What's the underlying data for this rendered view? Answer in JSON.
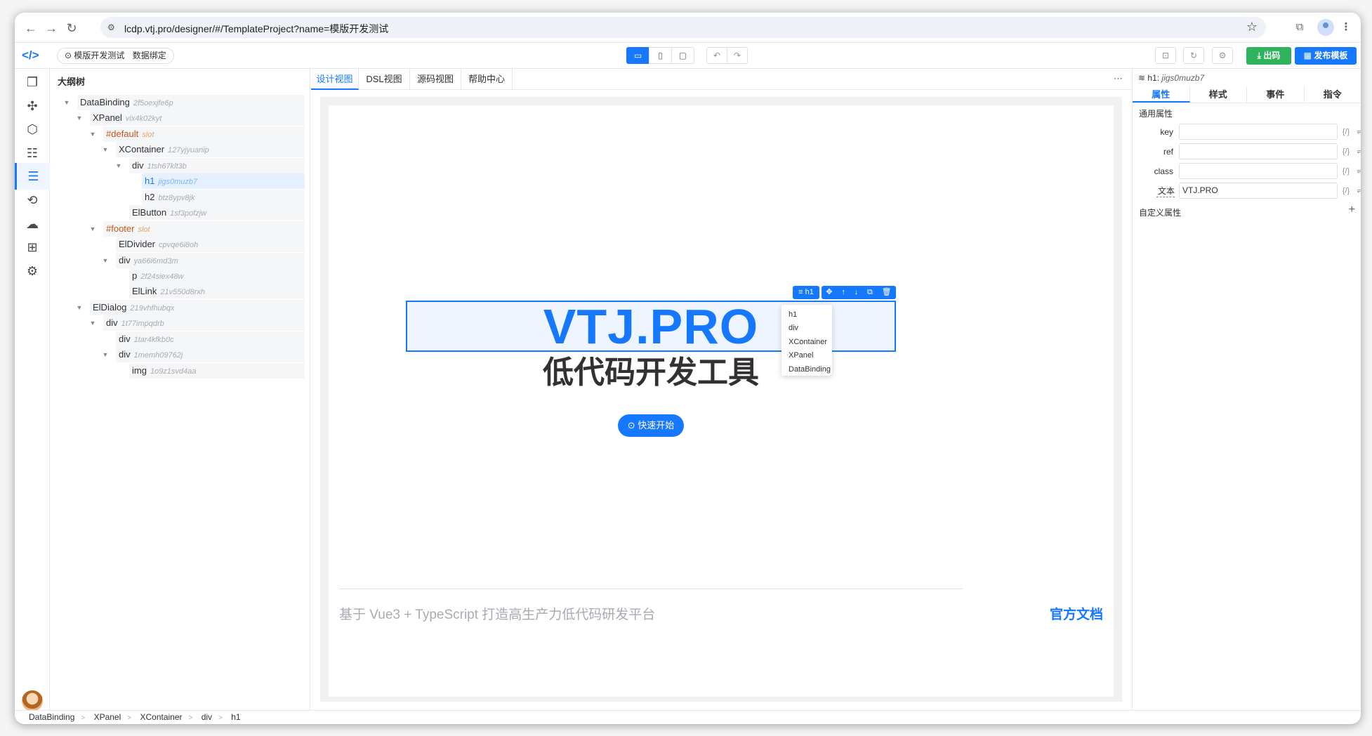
{
  "browser": {
    "url": "lcdp.vtj.pro/designer/#/TemplateProject?name=模版开发测试",
    "back_icon": "arrow-left-icon",
    "forward_icon": "arrow-right-icon",
    "reload_icon": "reload-icon"
  },
  "toolbar": {
    "project_name": "模版开发测试",
    "data_binding": "数据绑定",
    "export_label": "出码",
    "publish_label": "发布模板"
  },
  "tree": {
    "title": "大纲树",
    "nodes": [
      {
        "name": "DataBinding",
        "id": "2f5oexjfe6p"
      },
      {
        "name": "XPanel",
        "id": "vix4k02kyt"
      },
      {
        "name": "#default",
        "id": "slot"
      },
      {
        "name": "XContainer",
        "id": "127yjyuanip"
      },
      {
        "name": "div",
        "id": "1tsh67klt3b"
      },
      {
        "name": "h1",
        "id": "jigs0muzb7"
      },
      {
        "name": "h2",
        "id": "btz8ypv8jk"
      },
      {
        "name": "ElButton",
        "id": "1sf3pofzjw"
      },
      {
        "name": "#footer",
        "id": "slot"
      },
      {
        "name": "ElDivider",
        "id": "cpvqe6i8oh"
      },
      {
        "name": "div",
        "id": "ya66i6md3m"
      },
      {
        "name": "p",
        "id": "2f24siex48w"
      },
      {
        "name": "ElLink",
        "id": "21v550d8rxh"
      },
      {
        "name": "ElDialog",
        "id": "219vhfhubqx"
      },
      {
        "name": "div",
        "id": "1t77impqdrb"
      },
      {
        "name": "div",
        "id": "1tar4kfkb0c"
      },
      {
        "name": "div",
        "id": "1memh09762j"
      },
      {
        "name": "img",
        "id": "1o9z1svd4aa"
      }
    ]
  },
  "center": {
    "tabs": [
      "设计视图",
      "DSL视图",
      "源码视图",
      "帮助中心"
    ],
    "h1_text": "VTJ.PRO",
    "h2_text": "低代码开发工具",
    "quick_start": "快速开始",
    "selected_tag": "h1",
    "popup_items": [
      "h1",
      "div",
      "XContainer",
      "XPanel",
      "DataBinding"
    ],
    "footer_text": "基于 Vue3 + TypeScript 打造高生产力低代码研发平台",
    "footer_link": "官方文档"
  },
  "right": {
    "selected_name": "h1:",
    "selected_id": "jigs0muzb7",
    "tabs": [
      "属性",
      "样式",
      "事件",
      "指令"
    ],
    "common_title": "通用属性",
    "props": [
      {
        "label": "key",
        "value": ""
      },
      {
        "label": "ref",
        "value": ""
      },
      {
        "label": "class",
        "value": ""
      },
      {
        "label": "文本",
        "value": "VTJ.PRO"
      }
    ],
    "custom_title": "自定义属性"
  },
  "statusbar": {
    "crumbs": [
      "DataBinding",
      "XPanel",
      "XContainer",
      "div",
      "h1"
    ]
  },
  "colors": {
    "accent": "#1677ff",
    "green": "#2fb35c",
    "slot": "#c7561b"
  }
}
